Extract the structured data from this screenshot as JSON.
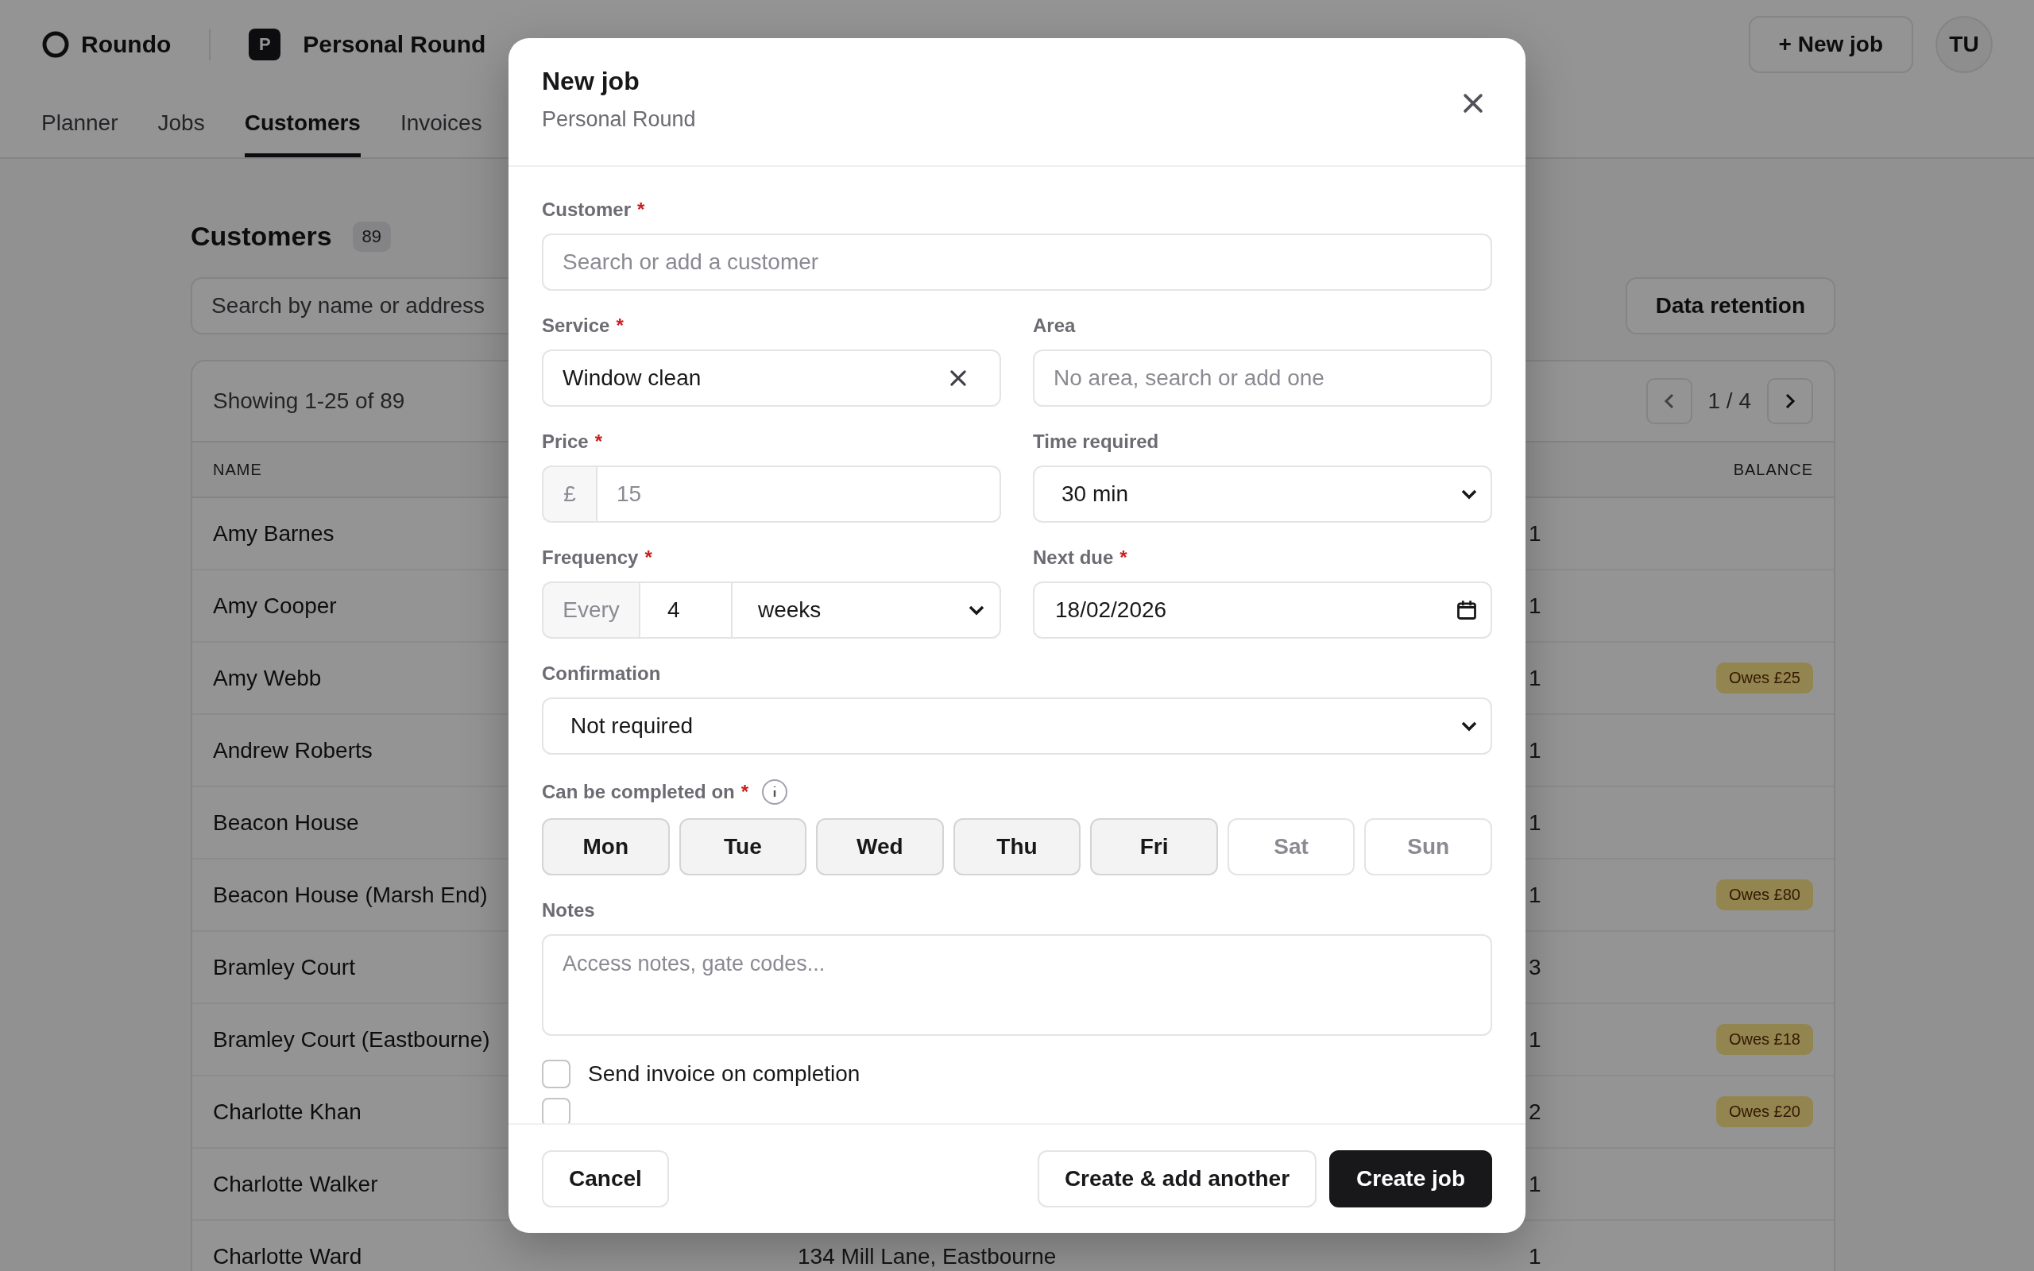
{
  "app": {
    "brand": "Roundo",
    "workspace": {
      "badge": "P",
      "name": "Personal Round"
    },
    "new_job_button": "+ New job",
    "avatar": "TU",
    "tabs": [
      {
        "label": "Planner",
        "selected": false
      },
      {
        "label": "Jobs",
        "selected": false
      },
      {
        "label": "Customers",
        "selected": true
      },
      {
        "label": "Invoices",
        "selected": false
      }
    ]
  },
  "customers": {
    "title": "Customers",
    "count": "89",
    "search": {
      "placeholder": "Search by name or address"
    },
    "data_retention_button": "Data retention",
    "showing": "Showing 1-25 of 89",
    "page": "1 / 4",
    "columns": {
      "name": "NAME",
      "balance": "BALANCE"
    },
    "rows": [
      {
        "name": "Amy Barnes",
        "jobs": "1"
      },
      {
        "name": "Amy Cooper",
        "jobs": "1"
      },
      {
        "name": "Amy Webb",
        "jobs": "1",
        "balance": "Owes £25"
      },
      {
        "name": "Andrew Roberts",
        "jobs": "1"
      },
      {
        "name": "Beacon House",
        "jobs": "1"
      },
      {
        "name": "Beacon House (Marsh End)",
        "jobs": "1",
        "balance": "Owes £80"
      },
      {
        "name": "Bramley Court",
        "jobs": "3"
      },
      {
        "name": "Bramley Court (Eastbourne)",
        "jobs": "1",
        "balance": "Owes £18"
      },
      {
        "name": "Charlotte Khan",
        "jobs": "2",
        "balance": "Owes £20"
      },
      {
        "name": "Charlotte Walker",
        "jobs": "1"
      },
      {
        "name": "Charlotte Ward",
        "address": "134 Mill Lane, Eastbourne",
        "jobs": "1"
      }
    ]
  },
  "dialog": {
    "title": "New job",
    "subtitle": "Personal Round",
    "customer": {
      "label": "Customer",
      "required_mark": "*",
      "placeholder": "Search or add a customer"
    },
    "service": {
      "label": "Service",
      "required_mark": "*",
      "value": "Window clean"
    },
    "area": {
      "label": "Area",
      "placeholder": "No area, search or add one"
    },
    "price": {
      "label": "Price",
      "required_mark": "*",
      "prefix": "£",
      "placeholder": "15"
    },
    "time_required": {
      "label": "Time required",
      "value": "30 min"
    },
    "frequency": {
      "label": "Frequency",
      "required_mark": "*",
      "prefix": "Every",
      "value": "4",
      "unit": "weeks"
    },
    "next_due": {
      "label": "Next due",
      "required_mark": "*",
      "value": "18/02/2026"
    },
    "confirmation": {
      "label": "Confirmation",
      "value": "Not required"
    },
    "days": {
      "label": "Can be completed on",
      "required_mark": "*",
      "items": [
        {
          "label": "Mon",
          "selected": true
        },
        {
          "label": "Tue",
          "selected": true
        },
        {
          "label": "Wed",
          "selected": true
        },
        {
          "label": "Thu",
          "selected": true
        },
        {
          "label": "Fri",
          "selected": true
        },
        {
          "label": "Sat",
          "selected": false
        },
        {
          "label": "Sun",
          "selected": false
        }
      ]
    },
    "notes": {
      "label": "Notes",
      "placeholder": "Access notes, gate codes..."
    },
    "options": [
      {
        "label": "Send invoice on completion",
        "checked": false
      },
      {
        "checked": false
      }
    ],
    "buttons": {
      "cancel": "Cancel",
      "secondary": "Create & add another",
      "primary": "Create job"
    }
  }
}
